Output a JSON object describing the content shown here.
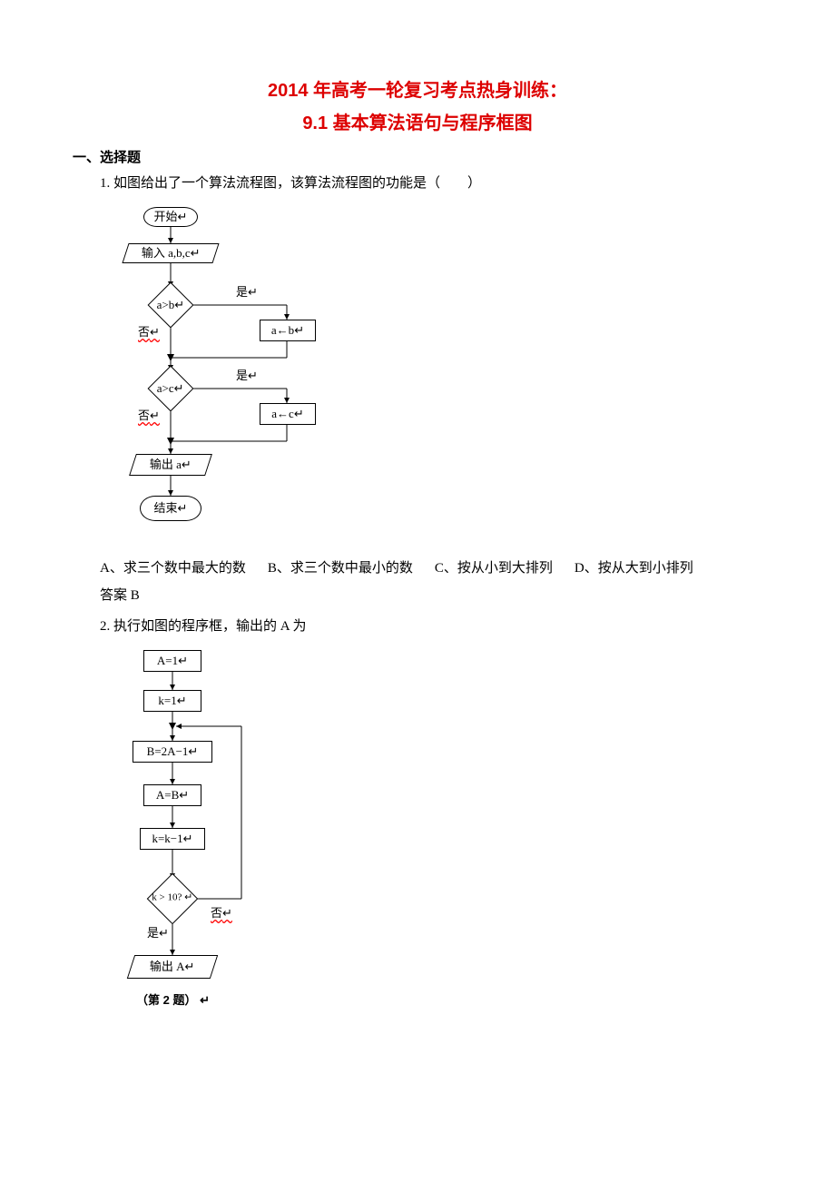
{
  "title_line1": "2014 年高考一轮复习考点热身训练：",
  "title_line2": "9.1 基本算法语句与程序框图",
  "section1": "一、选择题",
  "q1": {
    "stem": "1. 如图给出了一个算法流程图，该算法流程图的功能是（　　）",
    "start": "开始",
    "input": "输入 a,b,c",
    "cond1": "a>b",
    "assign1": "a←b",
    "cond2": "a>c",
    "assign2": "a←c",
    "output": "输出 a",
    "end": "结束",
    "yes": "是",
    "no": "否",
    "optA": "A、求三个数中最大的数",
    "optB": "B、求三个数中最小的数",
    "optC": "C、按从小到大排列",
    "optD": "D、按从大到小排列",
    "answer": "答案 B"
  },
  "q2": {
    "stem": "2. 执行如图的程序框，输出的 A 为",
    "a1": "A=1",
    "k1": "k=1",
    "bexpr": "B=2A−1",
    "ab": "A=B",
    "kinc": "k=k−1",
    "cond": "k > 10?",
    "yes": "是",
    "no": "否",
    "out": "输出 A",
    "caption": "（第 2 题）"
  }
}
